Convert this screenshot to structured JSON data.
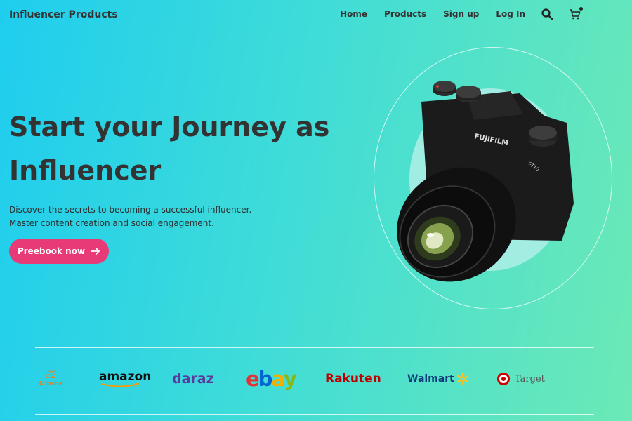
{
  "header": {
    "brand": "Influencer Products",
    "nav": [
      "Home",
      "Products",
      "Sign up",
      "Log In"
    ],
    "icons": [
      "search-icon",
      "cart-icon"
    ]
  },
  "hero": {
    "title_line1": "Start your Journey as",
    "title_line2": "Influencer",
    "subtitle_line1": "Discover the secrets to becoming a successful influencer.",
    "subtitle_line2": "Master content creation and social engagement.",
    "cta_label": "Preebook now",
    "camera_brand": "FUJIFILM",
    "camera_model": "X-T10"
  },
  "partners": {
    "alibaba": "Alibaba",
    "amazon": "amazon",
    "daraz": "daraz",
    "ebay": [
      "e",
      "b",
      "a",
      "y"
    ],
    "rakuten": "Rakuten",
    "walmart": "Walmart",
    "target": "Target"
  },
  "colors": {
    "gradient_start": "#1fcdee",
    "gradient_end": "#6ce9b6",
    "cta": "#e83a76",
    "text": "#333333"
  }
}
